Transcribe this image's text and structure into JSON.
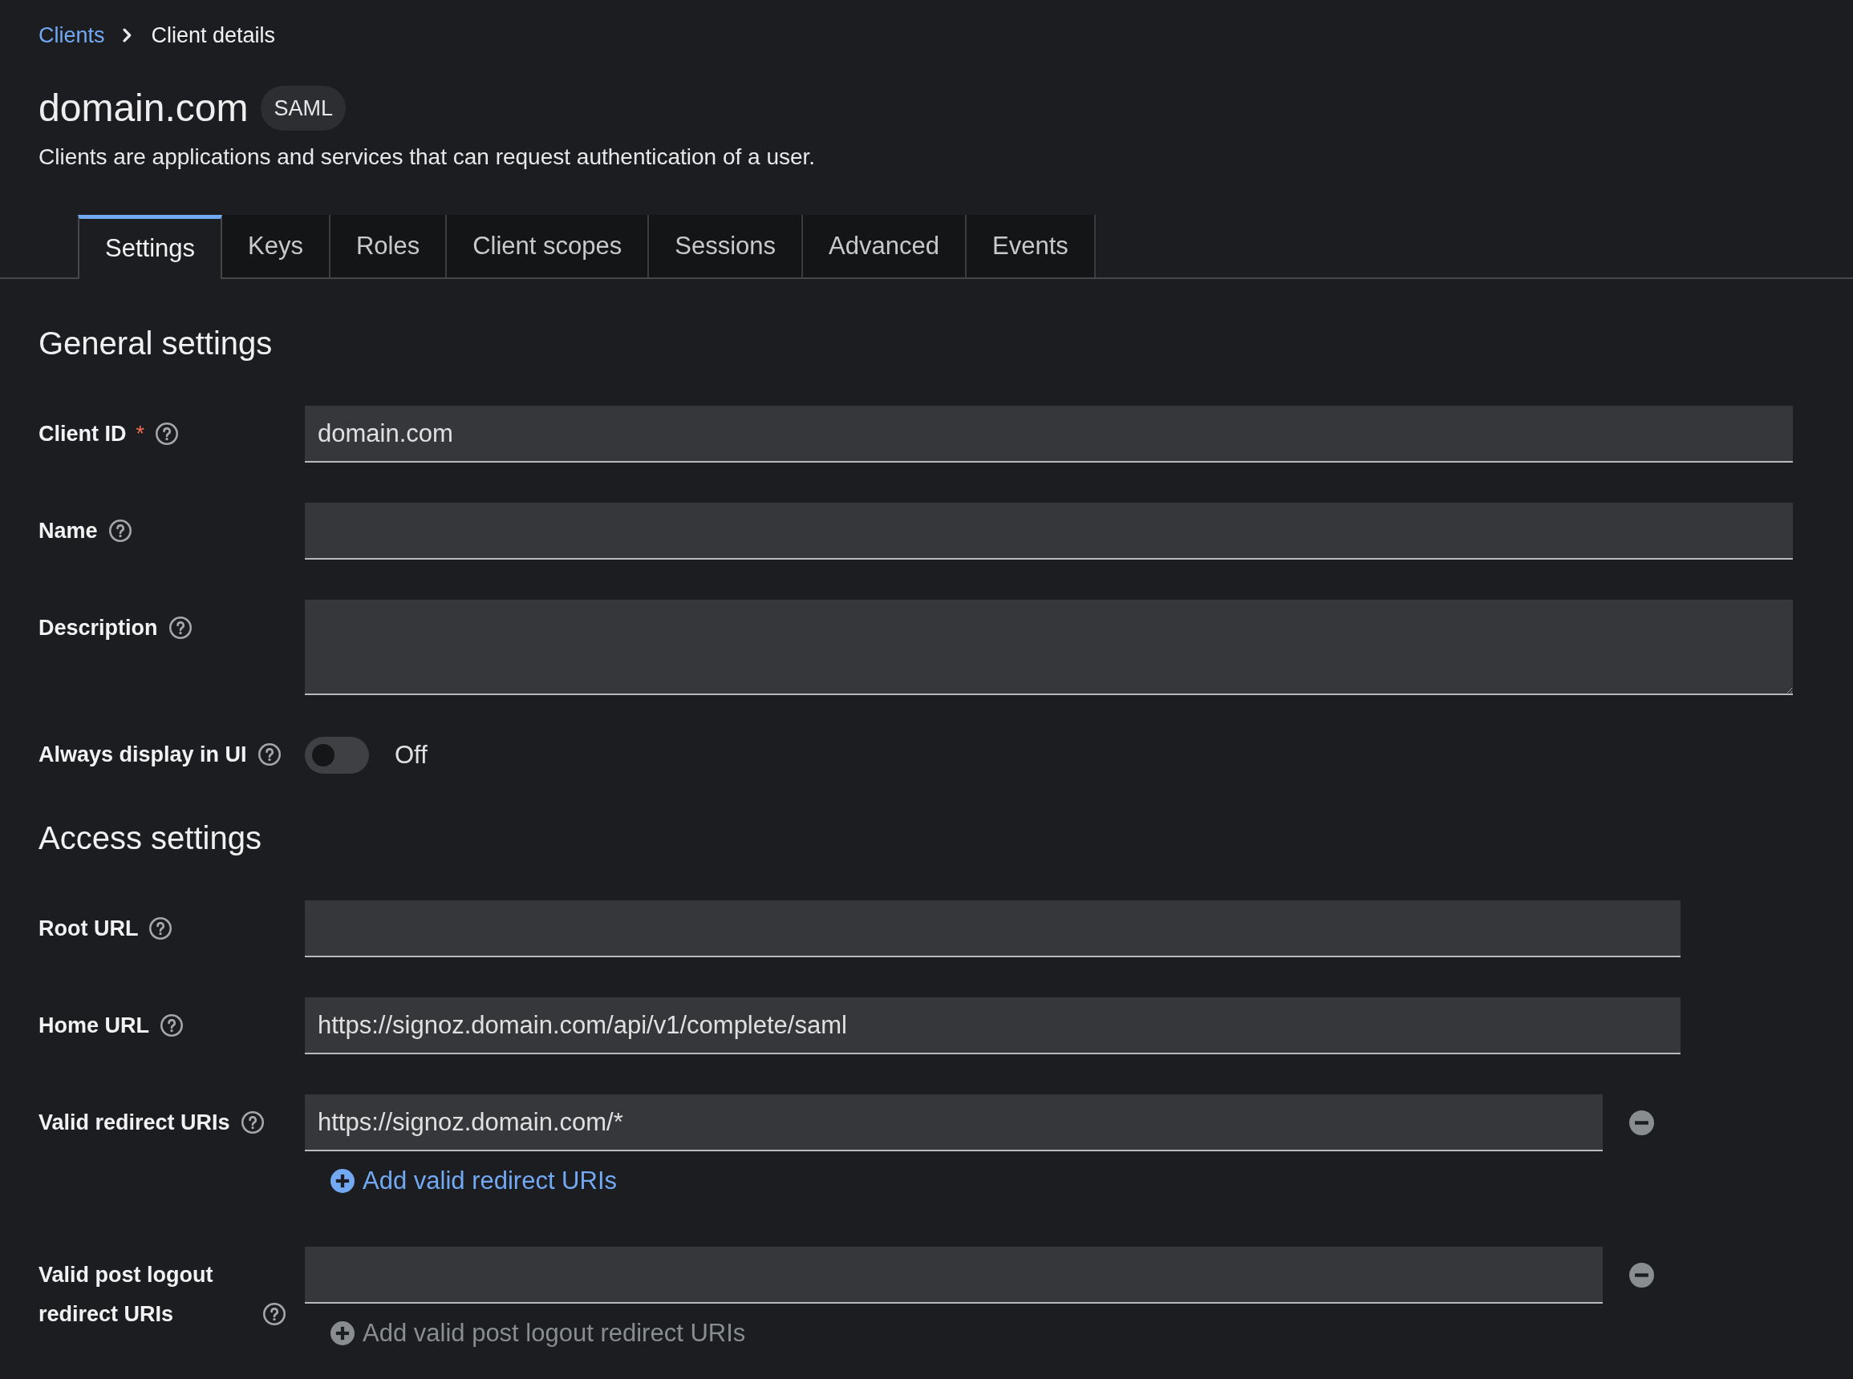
{
  "breadcrumb": [
    {
      "label": "Clients",
      "current": false
    },
    {
      "label": "Client details",
      "current": true
    }
  ],
  "header": {
    "title": "domain.com",
    "badge": "SAML",
    "description": "Clients are applications and services that can request authentication of a user."
  },
  "tabs": [
    {
      "label": "Settings",
      "selected": true
    },
    {
      "label": "Keys",
      "selected": false
    },
    {
      "label": "Roles",
      "selected": false
    },
    {
      "label": "Client scopes",
      "selected": false
    },
    {
      "label": "Sessions",
      "selected": false
    },
    {
      "label": "Advanced",
      "selected": false
    },
    {
      "label": "Events",
      "selected": false
    }
  ],
  "sections": [
    {
      "title": "General settings",
      "fields": [
        {
          "kind": "text",
          "label": "Client ID",
          "required_mark": "*",
          "value": "domain.com"
        },
        {
          "kind": "text",
          "label": "Name"
        },
        {
          "kind": "textarea",
          "label": "Description"
        },
        {
          "kind": "toggle",
          "label": "Always display in UI",
          "on": false,
          "state_label": "Off"
        }
      ]
    },
    {
      "title": "Access settings",
      "fields": [
        {
          "kind": "text",
          "label": "Root URL"
        },
        {
          "kind": "text",
          "label": "Home URL",
          "value": "https://signoz.domain.com/api/v1/complete/saml"
        },
        {
          "kind": "multi",
          "label": "Valid redirect URIs",
          "values": [
            "https://signoz.domain.com/*"
          ],
          "add_link": {
            "label": "Add valid redirect URIs",
            "disabled": false
          }
        },
        {
          "kind": "multi",
          "label": "Valid post logout redirect URIs",
          "add_link": {
            "label": "Add valid post logout redirect URIs",
            "disabled": true
          }
        }
      ]
    }
  ]
}
